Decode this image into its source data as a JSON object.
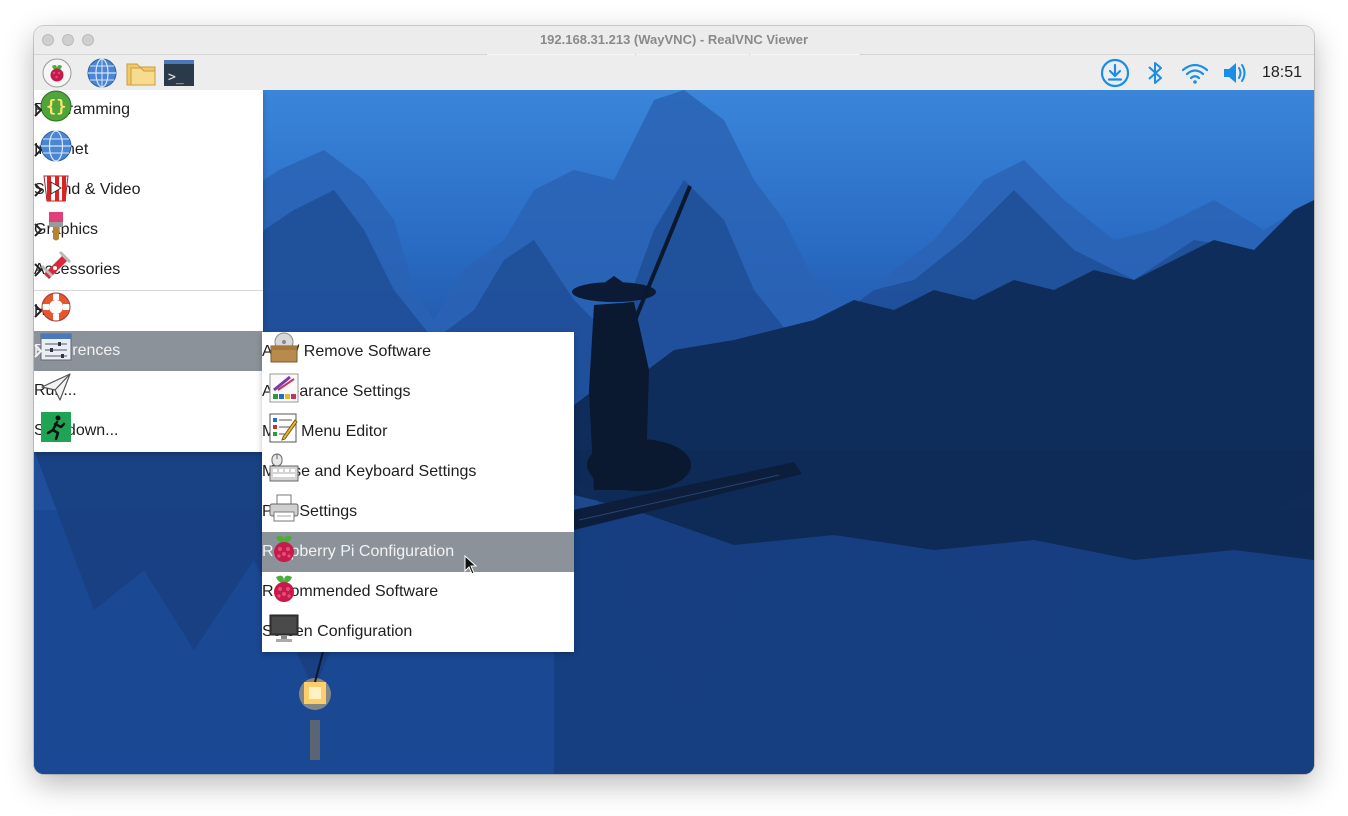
{
  "window": {
    "title": "192.168.31.213 (WayVNC) - RealVNC Viewer"
  },
  "taskbar": {
    "launchers": [
      "raspberry-menu-icon",
      "browser-globe-icon",
      "file-manager-icon",
      "terminal-icon"
    ],
    "tray": [
      "update-download-icon",
      "bluetooth-icon",
      "wifi-icon",
      "volume-icon"
    ],
    "clock": "18:51"
  },
  "main_menu": {
    "items": [
      {
        "label": "Programming",
        "icon": "programming-braces-icon",
        "submenu": true
      },
      {
        "label": "Internet",
        "icon": "globe-icon",
        "submenu": true
      },
      {
        "label": "Sound & Video",
        "icon": "popcorn-icon",
        "submenu": true
      },
      {
        "label": "Graphics",
        "icon": "paintbrush-icon",
        "submenu": true
      },
      {
        "label": "Accessories",
        "icon": "pocket-knife-icon",
        "submenu": true
      },
      {
        "label": "Help",
        "icon": "lifebuoy-icon",
        "submenu": true
      },
      {
        "label": "Preferences",
        "icon": "sliders-icon",
        "submenu": true,
        "active": true
      },
      {
        "label": "Run...",
        "icon": "paper-plane-icon",
        "submenu": false
      },
      {
        "label": "Shutdown...",
        "icon": "running-man-icon",
        "submenu": false
      }
    ]
  },
  "preferences_menu": {
    "items": [
      {
        "label": "Add / Remove Software",
        "icon": "software-box-icon"
      },
      {
        "label": "Appearance Settings",
        "icon": "palette-icon"
      },
      {
        "label": "Main Menu Editor",
        "icon": "menu-editor-icon"
      },
      {
        "label": "Mouse and Keyboard Settings",
        "icon": "keyboard-mouse-icon"
      },
      {
        "label": "Print Settings",
        "icon": "printer-icon"
      },
      {
        "label": "Raspberry Pi Configuration",
        "icon": "raspberry-icon",
        "highlighted": true
      },
      {
        "label": "Recommended Software",
        "icon": "raspberry-icon"
      },
      {
        "label": "Screen Configuration",
        "icon": "monitor-icon"
      }
    ]
  },
  "colors": {
    "menu_highlight": "#8b929a",
    "tray_accent": "#1a8ee6",
    "desktop_sky": "#3a86da"
  }
}
